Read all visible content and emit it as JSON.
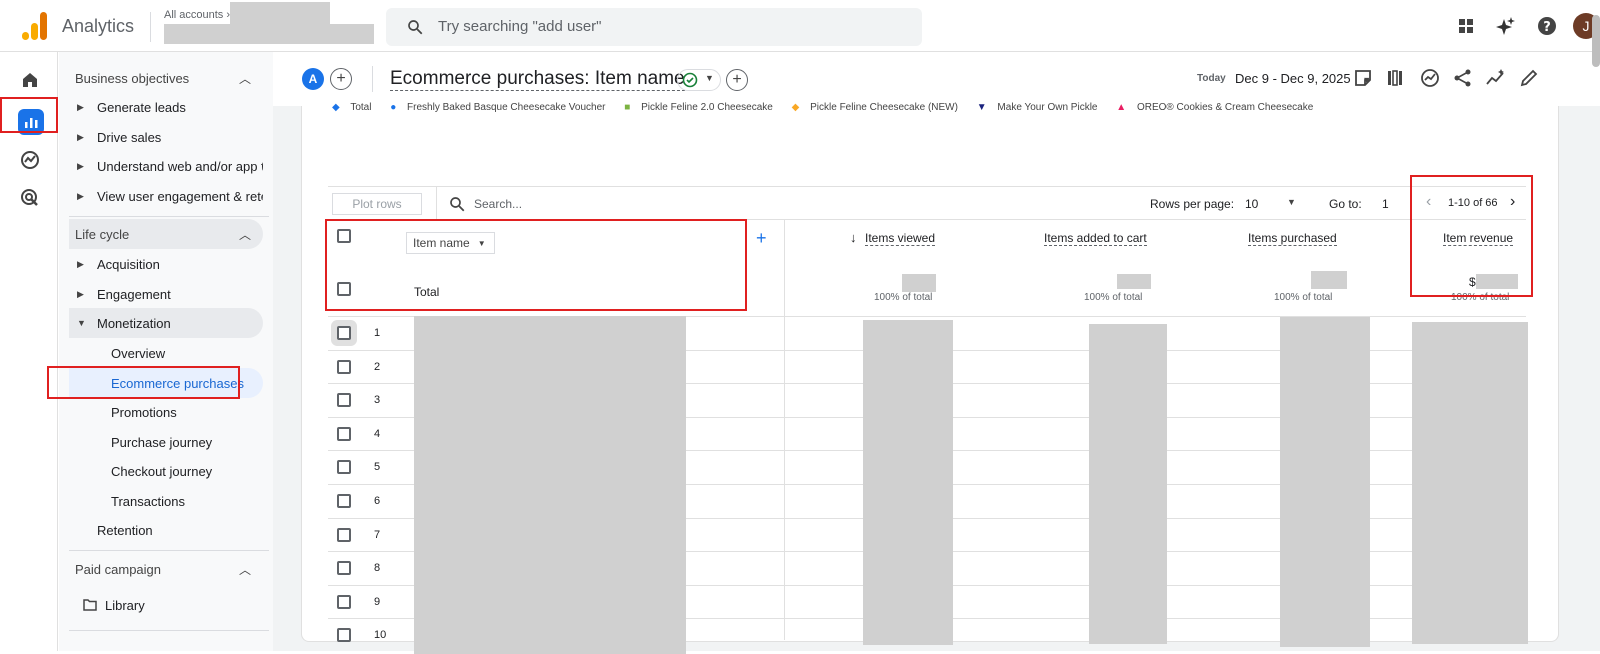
{
  "app": {
    "title": "Analytics",
    "breadcrumb": "All accounts",
    "profile_initial": "J"
  },
  "search": {
    "placeholder": "Try searching \"add user\""
  },
  "sidebar": {
    "business_objectives": "Business objectives",
    "bo_items": [
      "Generate leads",
      "Drive sales",
      "Understand web and/or app t...",
      "View user engagement & rete..."
    ],
    "life_cycle": "Life cycle",
    "lc_items": [
      "Acquisition",
      "Engagement",
      "Monetization"
    ],
    "monetization_sub": [
      "Overview",
      "Ecommerce purchases",
      "Promotions",
      "Purchase journey",
      "Checkout journey",
      "Transactions"
    ],
    "retention": "Retention",
    "paid_campaign": "Paid campaign",
    "library": "Library"
  },
  "report": {
    "avatar": "A",
    "title": "Ecommerce purchases: Item name",
    "today": "Today",
    "date_range": "Dec 9 - Dec 9, 2025"
  },
  "legend": [
    "Total",
    "Freshly Baked Basque Cheesecake Voucher",
    "Pickle Feline 2.0 Cheesecake",
    "Pickle Feline Cheesecake (NEW)",
    "Make Your Own Pickle",
    "OREO® Cookies & Cream Cheesecake"
  ],
  "legend_colors": [
    "#1a73e8",
    "#1a73e8",
    "#7cb342",
    "#f9a825",
    "#1a237e",
    "#e91e63"
  ],
  "toolbar": {
    "plot_rows": "Plot rows",
    "search_placeholder": "Search...",
    "rows_per_page_label": "Rows per page:",
    "rows_per_page": "10",
    "goto_label": "Go to:",
    "goto_value": "1",
    "range": "1-10 of 66"
  },
  "table": {
    "dimension": "Item name",
    "metrics": [
      "Items viewed",
      "Items added to cart",
      "Items purchased",
      "Item revenue"
    ],
    "total_label": "Total",
    "pct_of_total": "100% of total",
    "currency": "$",
    "row_numbers": [
      "1",
      "2",
      "3",
      "4",
      "5",
      "6",
      "7",
      "8",
      "9",
      "10"
    ]
  }
}
